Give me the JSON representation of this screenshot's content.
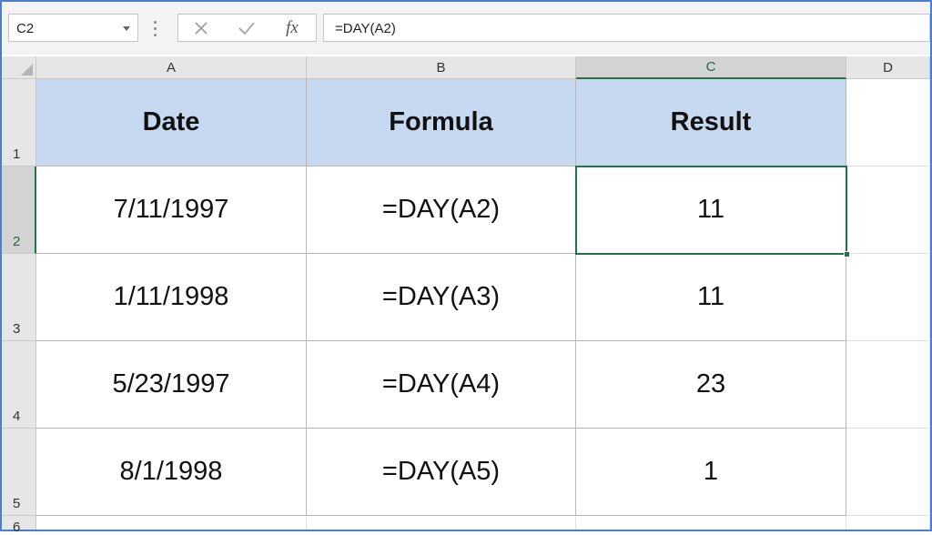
{
  "formula_bar": {
    "name_box": "C2",
    "cancel_icon": "x-icon",
    "enter_icon": "check-icon",
    "function_icon_text": "fx",
    "formula": "=DAY(A2)"
  },
  "columns": [
    "A",
    "B",
    "C",
    "D"
  ],
  "selected_column": "C",
  "rows": [
    "1",
    "2",
    "3",
    "4",
    "5",
    "6"
  ],
  "selected_row": "2",
  "table": {
    "headers": [
      "Date",
      "Formula",
      "Result"
    ],
    "rows": [
      [
        "7/11/1997",
        "=DAY(A2)",
        "11"
      ],
      [
        "1/11/1998",
        "=DAY(A3)",
        "11"
      ],
      [
        "5/23/1997",
        "=DAY(A4)",
        "23"
      ],
      [
        "8/1/1998",
        "=DAY(A5)",
        "1"
      ]
    ]
  },
  "colors": {
    "header_fill": "#c6d9f1",
    "selection": "#217346",
    "frame": "#4a7fd0"
  }
}
